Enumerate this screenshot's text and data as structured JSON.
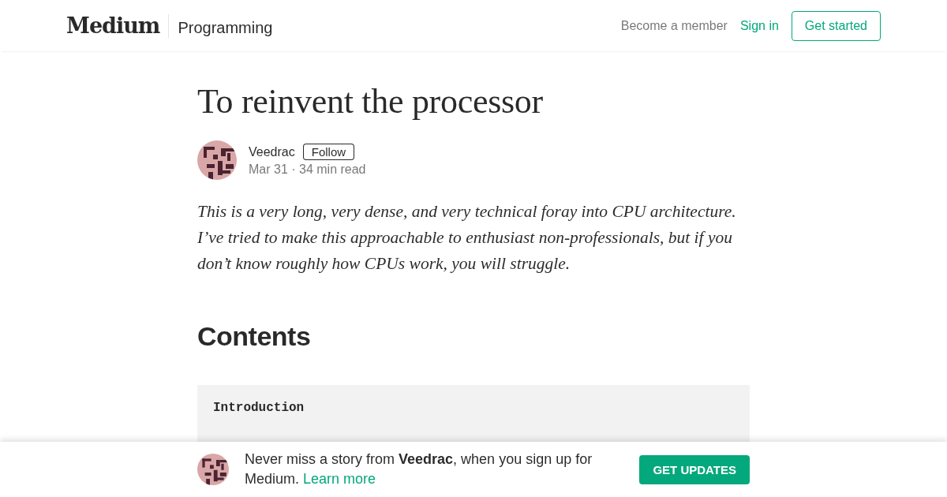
{
  "header": {
    "logo": "Medium",
    "publication": "Programming",
    "links": [
      {
        "label": "Become a member",
        "kind": "muted"
      },
      {
        "label": "Sign in",
        "kind": "accent"
      }
    ],
    "cta": "Get started"
  },
  "article": {
    "title": "To reinvent the processor",
    "author": "Veedrac",
    "follow": "Follow",
    "meta": "Mar 31 · 34 min read",
    "intro": "This is a very long, very dense, and very technical foray into CPU architecture. I’ve tried to make this approachable to enthusiast non-professionals, but if you don’t know roughly how CPUs work, you will struggle.",
    "heading": "Contents",
    "code_lines": [
      "Introduction"
    ]
  },
  "banner": {
    "text": "Never miss a story from **Veedrac**, when you sign up for Medium.",
    "link": "Learn more",
    "button": "GET UPDATES"
  }
}
